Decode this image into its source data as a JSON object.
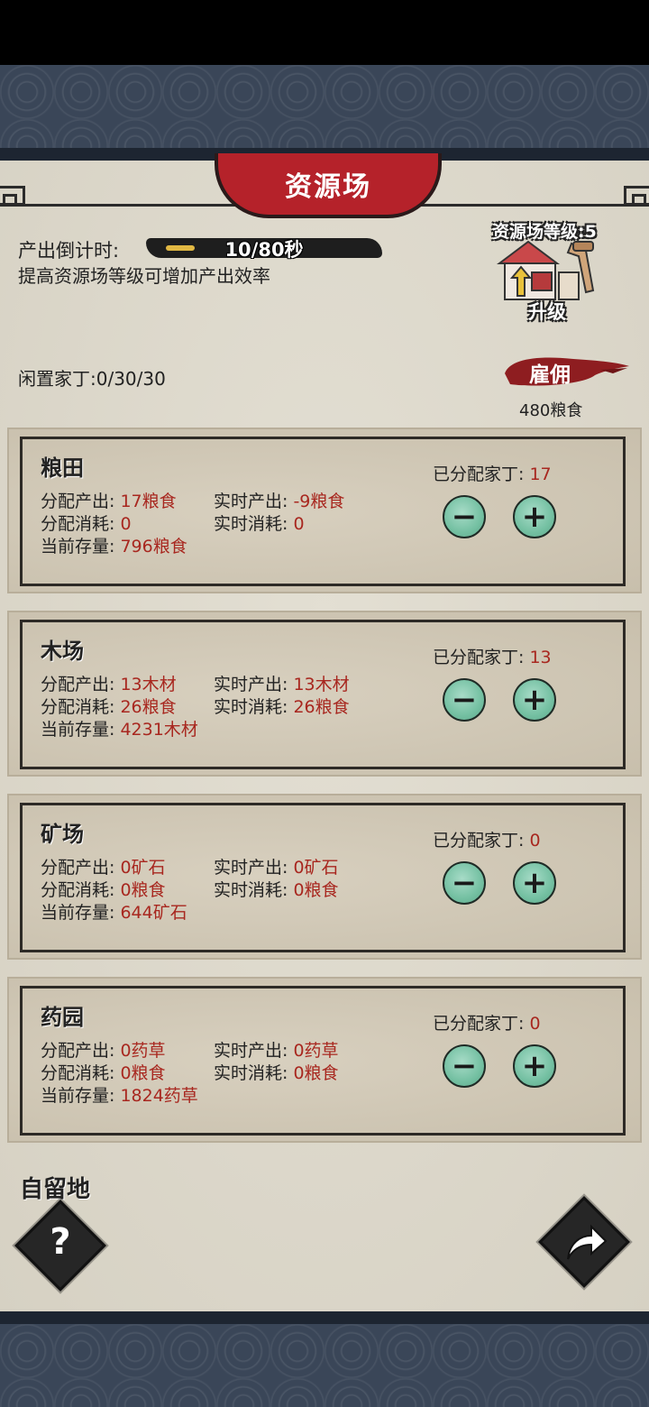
{
  "header": {
    "title": "资源场"
  },
  "production": {
    "countdown_label": "产出倒计时:",
    "countdown_value": "10/80秒",
    "countdown_progress": 0.125,
    "hint": "提高资源场等级可增加产出效率"
  },
  "upgrade": {
    "level_label": "资源场等级:5",
    "button_label": "升级",
    "icon": "house-upgrade-icon"
  },
  "workers": {
    "idle_label": "闲置家丁:0/30/30",
    "hire_label": "雇佣",
    "hire_cost": "480粮食"
  },
  "cards": [
    {
      "name": "粮田",
      "assigned_label": "已分配家丁:",
      "assigned_value": "17",
      "alloc_output_label": "分配产出:",
      "alloc_output_value": "17粮食",
      "real_output_label": "实时产出:",
      "real_output_value": "-9粮食",
      "alloc_consume_label": "分配消耗:",
      "alloc_consume_value": "0",
      "real_consume_label": "实时消耗:",
      "real_consume_value": "0",
      "stock_label": "当前存量:",
      "stock_value": "796粮食"
    },
    {
      "name": "木场",
      "assigned_label": "已分配家丁:",
      "assigned_value": "13",
      "alloc_output_label": "分配产出:",
      "alloc_output_value": "13木材",
      "real_output_label": "实时产出:",
      "real_output_value": "13木材",
      "alloc_consume_label": "分配消耗:",
      "alloc_consume_value": "26粮食",
      "real_consume_label": "实时消耗:",
      "real_consume_value": "26粮食",
      "stock_label": "当前存量:",
      "stock_value": "4231木材"
    },
    {
      "name": "矿场",
      "assigned_label": "已分配家丁:",
      "assigned_value": "0",
      "alloc_output_label": "分配产出:",
      "alloc_output_value": "0矿石",
      "real_output_label": "实时产出:",
      "real_output_value": "0矿石",
      "alloc_consume_label": "分配消耗:",
      "alloc_consume_value": "0粮食",
      "real_consume_label": "实时消耗:",
      "real_consume_value": "0粮食",
      "stock_label": "当前存量:",
      "stock_value": "644矿石"
    },
    {
      "name": "药园",
      "assigned_label": "已分配家丁:",
      "assigned_value": "0",
      "alloc_output_label": "分配产出:",
      "alloc_output_value": "0药草",
      "real_output_label": "实时产出:",
      "real_output_value": "0药草",
      "alloc_consume_label": "分配消耗:",
      "alloc_consume_value": "0粮食",
      "real_consume_label": "实时消耗:",
      "real_consume_value": "0粮食",
      "stock_label": "当前存量:",
      "stock_value": "1824药草"
    }
  ],
  "footer": {
    "self_land_label": "自留地",
    "help_glyph": "?",
    "help_icon": "question-icon",
    "share_icon": "share-arrow-icon"
  },
  "colors": {
    "accent_red": "#b5222a",
    "value_red": "#a8271f",
    "button_jade": "#74c0a2",
    "parchment": "#dcd8cb"
  }
}
